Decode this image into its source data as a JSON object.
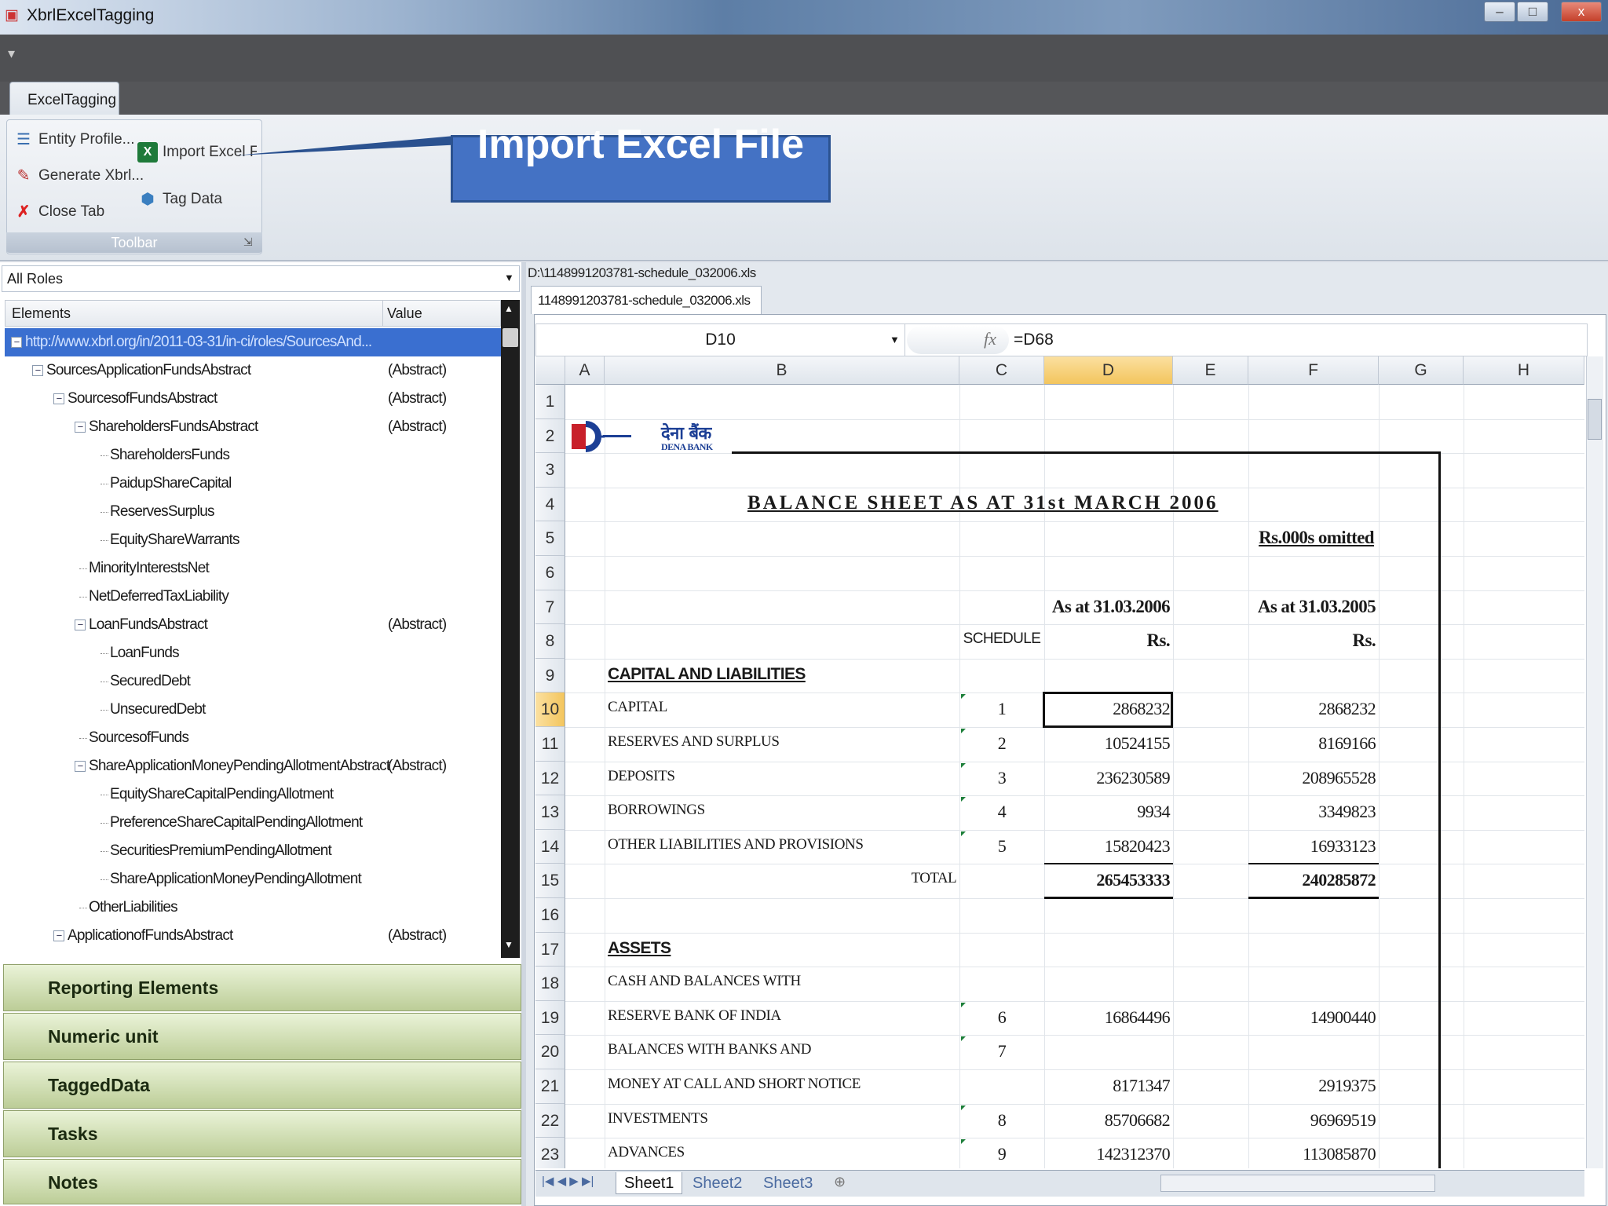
{
  "window": {
    "title": "XbrlExcelTagging",
    "min": "–",
    "max": "□",
    "close": "x"
  },
  "ribbon": {
    "tab": "ExcelTagging",
    "group_label": "Toolbar",
    "buttons": {
      "entity_profile": "Entity Profile...",
      "generate_xbrl": "Generate Xbrl...",
      "close_tab": "Close Tab",
      "import_excel": "Import Excel File",
      "tag_data": "Tag Data"
    }
  },
  "callout": "Import Excel File",
  "left": {
    "roles": "All Roles",
    "headers": {
      "elements": "Elements",
      "value": "Value"
    },
    "tree": [
      {
        "label": "http://www.xbrl.org/in/2011-03-31/in-ci/roles/SourcesAnd...",
        "value": "",
        "level": 0,
        "toggle": true,
        "selected": true
      },
      {
        "label": "SourcesApplicationFundsAbstract",
        "value": "(Abstract)",
        "level": 1,
        "toggle": true
      },
      {
        "label": "SourcesofFundsAbstract",
        "value": "(Abstract)",
        "level": 2,
        "toggle": true
      },
      {
        "label": "ShareholdersFundsAbstract",
        "value": "(Abstract)",
        "level": 3,
        "toggle": true
      },
      {
        "label": "ShareholdersFunds",
        "value": "",
        "level": 4
      },
      {
        "label": "PaidupShareCapital",
        "value": "",
        "level": 4
      },
      {
        "label": "ReservesSurplus",
        "value": "",
        "level": 4
      },
      {
        "label": "EquityShareWarrants",
        "value": "",
        "level": 4
      },
      {
        "label": "MinorityInterestsNet",
        "value": "",
        "level": 3
      },
      {
        "label": "NetDeferredTaxLiability",
        "value": "",
        "level": 3
      },
      {
        "label": "LoanFundsAbstract",
        "value": "(Abstract)",
        "level": 3,
        "toggle": true
      },
      {
        "label": "LoanFunds",
        "value": "",
        "level": 4
      },
      {
        "label": "SecuredDebt",
        "value": "",
        "level": 4
      },
      {
        "label": "UnsecuredDebt",
        "value": "",
        "level": 4
      },
      {
        "label": "SourcesofFunds",
        "value": "",
        "level": 3
      },
      {
        "label": "ShareApplicationMoneyPendingAllotmentAbstract",
        "value": "(Abstract)",
        "level": 3,
        "toggle": true
      },
      {
        "label": "EquityShareCapitalPendingAllotment",
        "value": "",
        "level": 4
      },
      {
        "label": "PreferenceShareCapitalPendingAllotment",
        "value": "",
        "level": 4
      },
      {
        "label": "SecuritiesPremiumPendingAllotment",
        "value": "",
        "level": 4
      },
      {
        "label": "ShareApplicationMoneyPendingAllotment",
        "value": "",
        "level": 4
      },
      {
        "label": "OtherLiabilities",
        "value": "",
        "level": 3
      },
      {
        "label": "ApplicationofFundsAbstract",
        "value": "(Abstract)",
        "level": 2,
        "toggle": true
      }
    ],
    "nav": [
      "Reporting Elements",
      "Numeric unit",
      "TaggedData",
      "Tasks",
      "Notes"
    ]
  },
  "right": {
    "file_path": "D:\\1148991203781-schedule_032006.xls",
    "file_tab": "1148991203781-schedule_032006.xls",
    "namebox": "D10",
    "fx": "fx",
    "formula": "=D68",
    "columns": [
      "A",
      "B",
      "C",
      "D",
      "E",
      "F",
      "G",
      "H"
    ],
    "rows": [
      "1",
      "2",
      "3",
      "4",
      "5",
      "6",
      "7",
      "8",
      "9",
      "10",
      "11",
      "12",
      "13",
      "14",
      "15",
      "16",
      "17",
      "18",
      "19",
      "20",
      "21",
      "22",
      "23"
    ],
    "logo": {
      "hindi": "देना बैंक",
      "english": "DENA BANK"
    },
    "sheet_title": "BALANCE SHEET   AS AT 31st MARCH 2006",
    "omitted_note": "Rs.000s omitted",
    "hdr_d": "As at 31.03.2006",
    "hdr_f": "As at 31.03.2005",
    "schedule_hdr": "SCHEDULE",
    "rs": "Rs.",
    "sec_liab": "CAPITAL AND LIABILITIES",
    "sec_assets": "ASSETS",
    "lines": [
      {
        "row": 10,
        "label": "CAPITAL",
        "sch": "1",
        "d": "2868232",
        "f": "2868232"
      },
      {
        "row": 11,
        "label": "RESERVES AND SURPLUS",
        "sch": "2",
        "d": "10524155",
        "f": "8169166"
      },
      {
        "row": 12,
        "label": "DEPOSITS",
        "sch": "3",
        "d": "236230589",
        "f": "208965528"
      },
      {
        "row": 13,
        "label": "BORROWINGS",
        "sch": "4",
        "d": "9934",
        "f": "3349823"
      },
      {
        "row": 14,
        "label": "OTHER LIABILITIES AND PROVISIONS",
        "sch": "5",
        "d": "15820423",
        "f": "16933123"
      },
      {
        "row": 18,
        "label": "CASH AND BALANCES  WITH",
        "sch": "",
        "d": "",
        "f": ""
      },
      {
        "row": 19,
        "label": "RESERVE BANK OF INDIA",
        "sch": "6",
        "d": "16864496",
        "f": "14900440"
      },
      {
        "row": 20,
        "label": "BALANCES WITH BANKS AND",
        "sch": "7",
        "d": "",
        "f": ""
      },
      {
        "row": 21,
        "label": "MONEY AT CALL AND SHORT NOTICE",
        "sch": "",
        "d": "8171347",
        "f": "2919375"
      },
      {
        "row": 22,
        "label": "INVESTMENTS",
        "sch": "8",
        "d": "85706682",
        "f": "96969519"
      },
      {
        "row": 23,
        "label": "ADVANCES",
        "sch": "9",
        "d": "142312370",
        "f": "113085870"
      }
    ],
    "total": {
      "label": "TOTAL",
      "d": "265453333",
      "f": "240285872"
    },
    "sheets": [
      "Sheet1",
      "Sheet2",
      "Sheet3"
    ],
    "active_sheet": "Sheet1"
  }
}
